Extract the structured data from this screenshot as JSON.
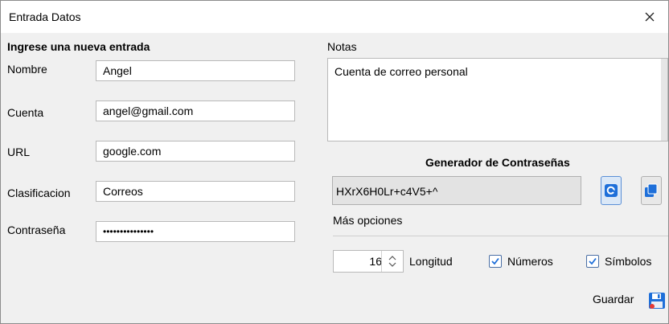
{
  "window": {
    "title": "Entrada Datos"
  },
  "form": {
    "heading": "Ingrese una nueva entrada",
    "name_label": "Nombre",
    "name_value": "Angel",
    "account_label": "Cuenta",
    "account_value": "angel@gmail.com",
    "url_label": "URL",
    "url_value": "google.com",
    "class_label": "Clasificacion",
    "class_value": "Correos",
    "password_label": "Contraseña",
    "password_value": "•••••••••••••••"
  },
  "notes": {
    "label": "Notas",
    "value": "Cuenta de correo personal"
  },
  "generator": {
    "heading": "Generador de Contraseñas",
    "generated": "HXrX6H0Lr+c4V5+^",
    "more_options": "Más opciones",
    "length_value": "16",
    "length_label": "Longitud",
    "numbers_label": "Números",
    "numbers_checked": true,
    "symbols_label": "Símbolos",
    "symbols_checked": true
  },
  "footer": {
    "save_label": "Guardar"
  },
  "icons": {
    "close": "close-icon",
    "regenerate": "refresh-icon",
    "copy": "copy-icon",
    "save": "floppy-disk-icon"
  },
  "colors": {
    "accent": "#1e6fd9",
    "checkbox_border": "#4a6fa5"
  }
}
